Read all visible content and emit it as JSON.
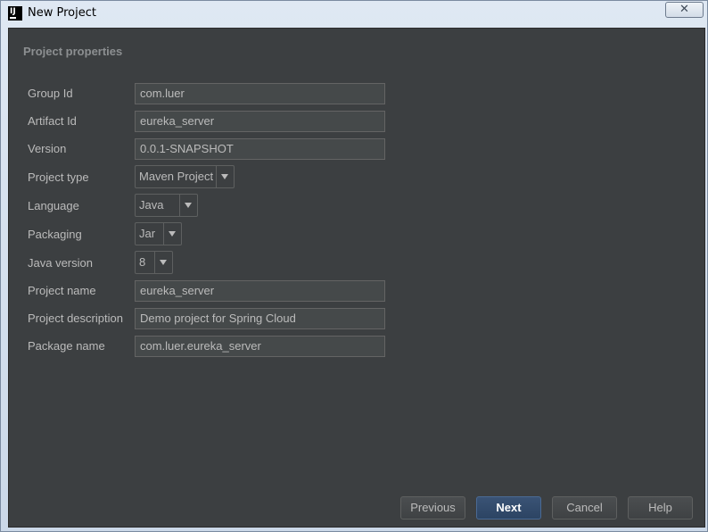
{
  "window": {
    "title": "New Project",
    "app_icon_text": "IJ",
    "close_glyph": "✕"
  },
  "section": {
    "title": "Project properties"
  },
  "fields": {
    "group_id": {
      "label": "Group Id",
      "value": "com.luer"
    },
    "artifact_id": {
      "label": "Artifact Id",
      "value": "eureka_server"
    },
    "version": {
      "label": "Version",
      "value": "0.0.1-SNAPSHOT"
    },
    "project_type": {
      "label": "Project type",
      "value": "Maven Project"
    },
    "language": {
      "label": "Language",
      "value": "Java"
    },
    "packaging": {
      "label": "Packaging",
      "value": "Jar"
    },
    "java_version": {
      "label": "Java version",
      "value": "8"
    },
    "project_name": {
      "label": "Project name",
      "value": "eureka_server"
    },
    "project_description": {
      "label": "Project description",
      "value": "Demo project for Spring Cloud"
    },
    "package_name": {
      "label": "Package name",
      "value": "com.luer.eureka_server"
    }
  },
  "buttons": {
    "previous": "Previous",
    "next": "Next",
    "cancel": "Cancel",
    "help": "Help"
  },
  "icons": {
    "dropdown": "chevron-down-icon",
    "close": "close-icon",
    "app": "intellij-idea-icon"
  }
}
